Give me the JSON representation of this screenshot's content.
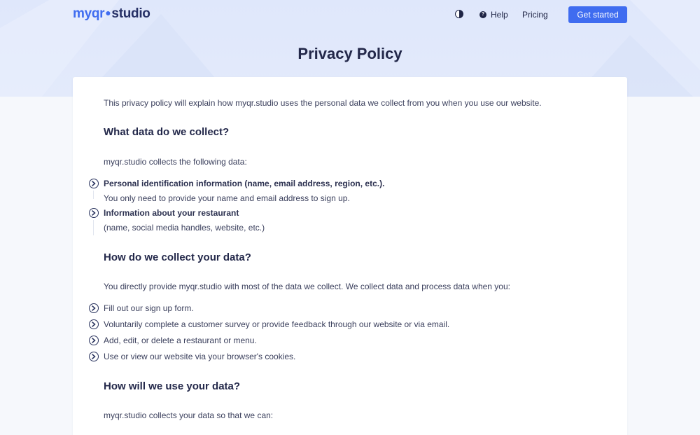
{
  "brand": {
    "logo_prefix": "myqr",
    "logo_suffix": "studio"
  },
  "nav": {
    "help_label": "Help",
    "pricing_label": "Pricing",
    "cta_label": "Get started"
  },
  "page": {
    "title": "Privacy Policy"
  },
  "policy": {
    "intro": "This privacy policy will explain how myqr.studio uses the personal data we collect from you when you use our website.",
    "section1": {
      "heading": "What data do we collect?",
      "lead": "myqr.studio collects the following data:",
      "items": [
        {
          "title": "Personal identification information (name, email address, region, etc.).",
          "detail": "You only need to provide your name and email address to sign up."
        },
        {
          "title": "Information about your restaurant",
          "detail": "(name, social media handles, website, etc.)"
        }
      ]
    },
    "section2": {
      "heading": "How do we collect your data?",
      "lead": "You directly provide myqr.studio with most of the data we collect. We collect data and process data when you:",
      "items": [
        "Fill out our sign up form.",
        "Voluntarily complete a customer survey or provide feedback through our website or via email.",
        "Add, edit, or delete a restaurant or menu.",
        "Use or view our website via your browser's cookies."
      ]
    },
    "section3": {
      "heading": "How will we use your data?",
      "lead": "myqr.studio collects your data so that we can:"
    }
  },
  "colors": {
    "accent": "#3f6cf0",
    "text_dark": "#23284a",
    "hero_bg": "#dfe7fb"
  },
  "icons": {
    "theme": "contrast-icon",
    "help": "question-circle-icon",
    "bullet": "chevron-circle-right-icon"
  }
}
